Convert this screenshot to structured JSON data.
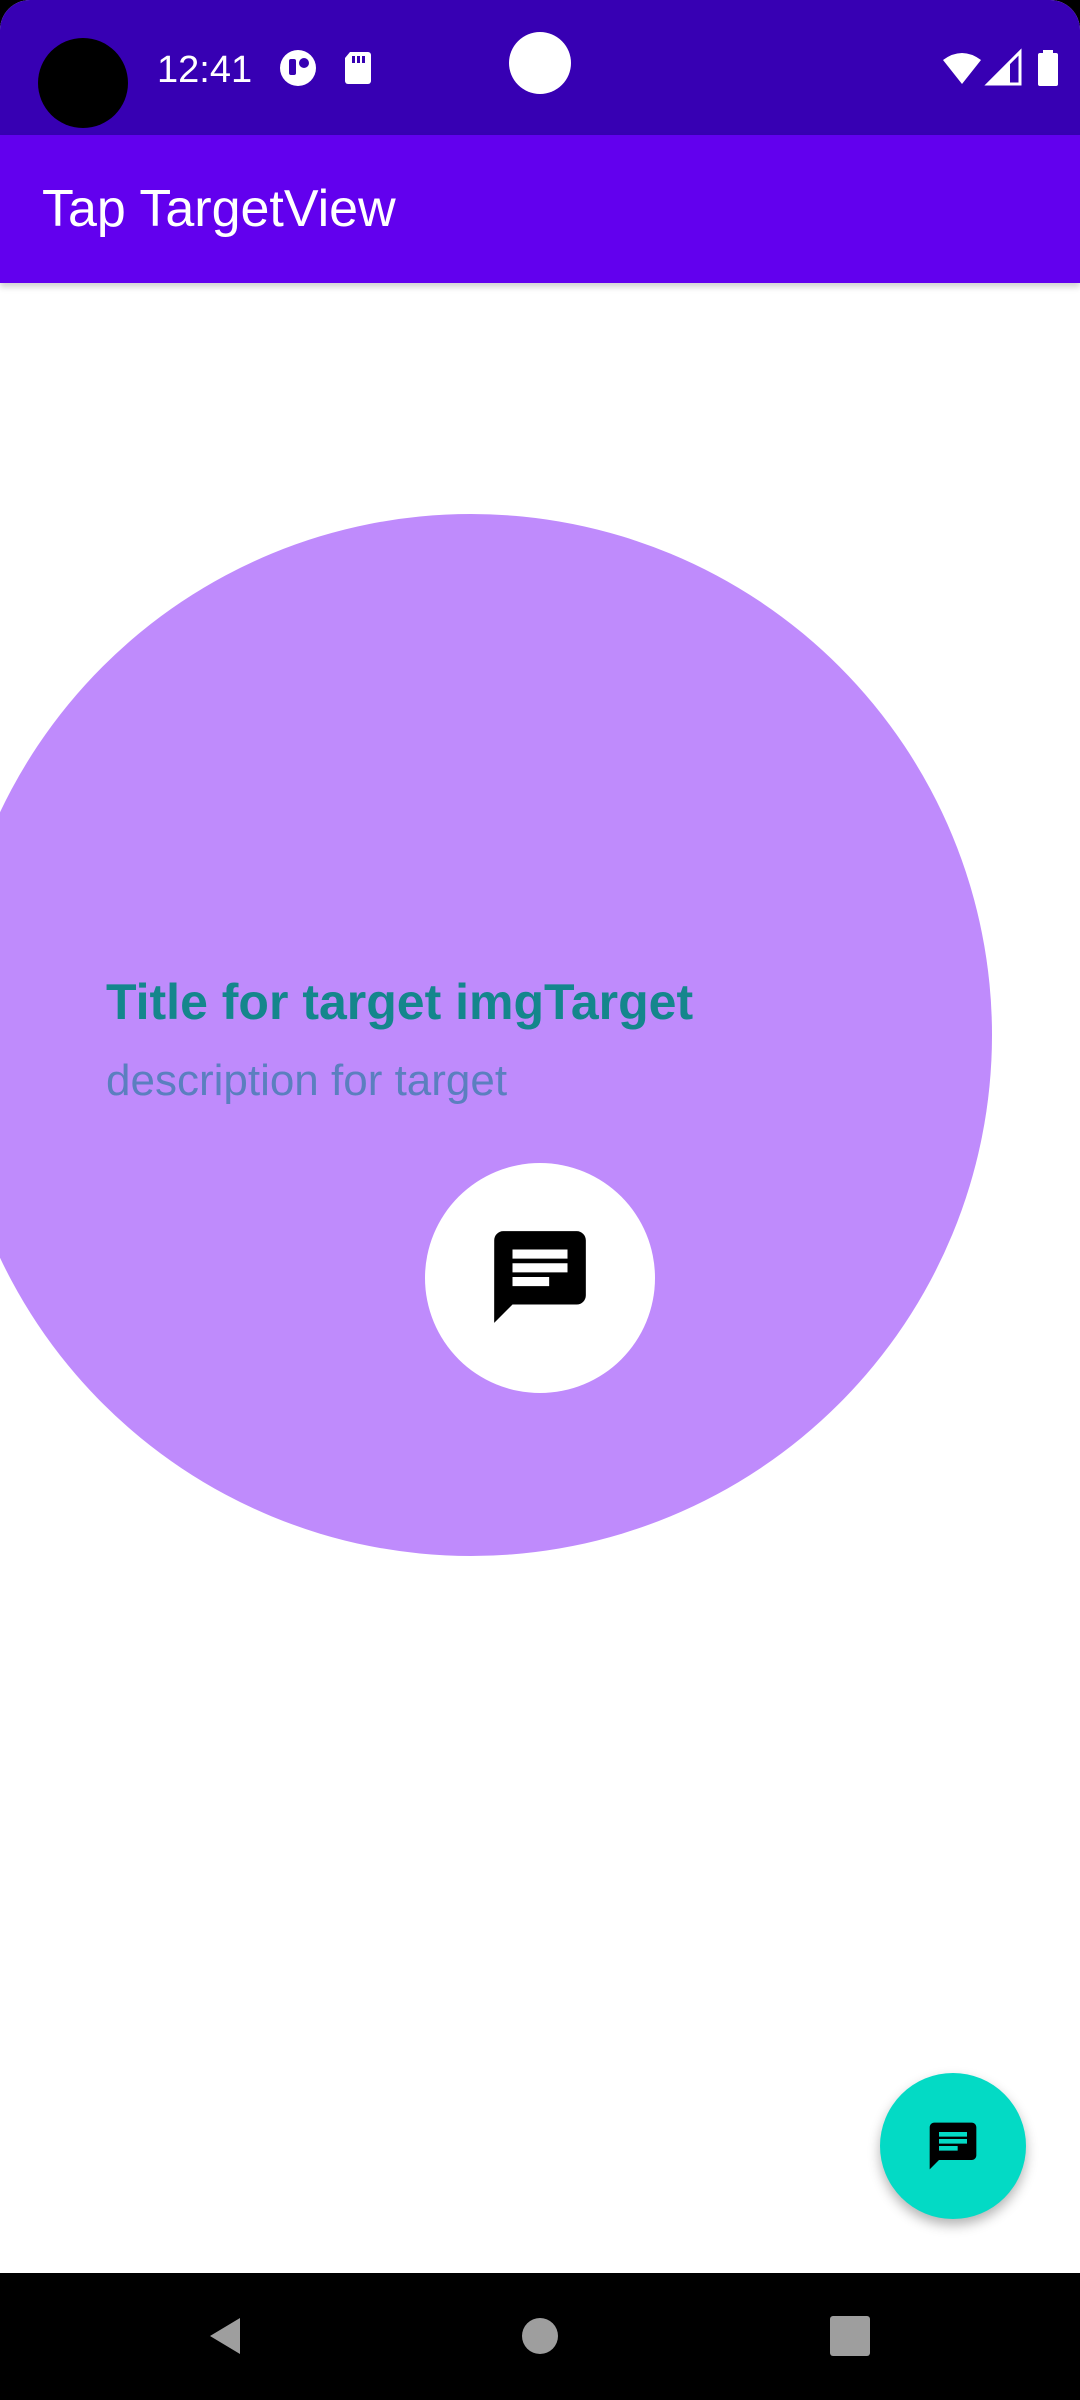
{
  "status_bar": {
    "time": "12:41",
    "icons": [
      "notification-app-icon",
      "sd-card-icon",
      "wifi-icon",
      "signal-icon",
      "battery-icon"
    ]
  },
  "app_bar": {
    "title": "Tap TargetView"
  },
  "target": {
    "title": "Title for target imgTarget",
    "description": "description for target",
    "icon": "message-icon",
    "outer_color": "#bf8bfc",
    "title_color": "#14868c",
    "description_color": "#5b7fbf"
  },
  "fab": {
    "icon": "message-icon",
    "color": "#03dac5"
  },
  "nav_bar": {
    "buttons": [
      "back-icon",
      "home-icon",
      "recents-icon"
    ]
  },
  "colors": {
    "status_bar": "#3700b3",
    "primary": "#6200ee"
  }
}
